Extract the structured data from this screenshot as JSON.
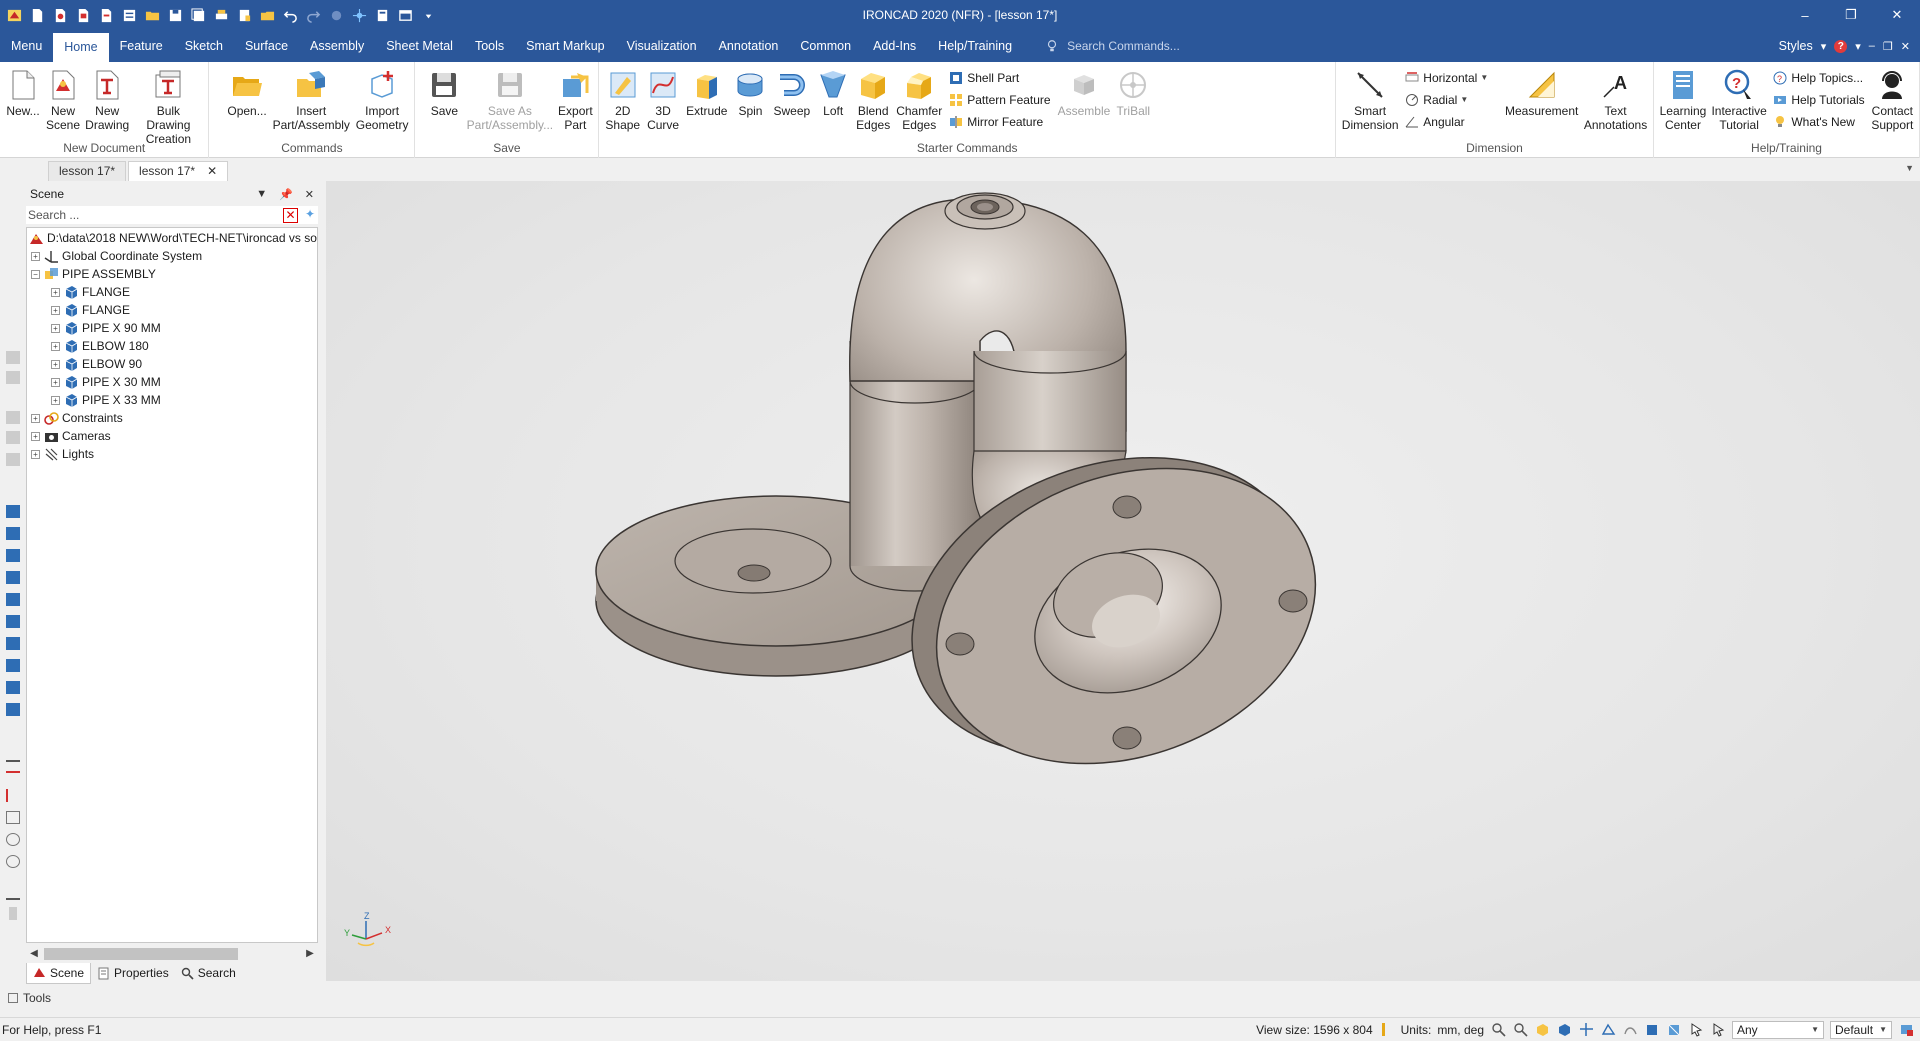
{
  "title_bar": {
    "app_title": "IRONCAD 2020 (NFR) - [lesson 17*]",
    "minimize": "–",
    "restore": "❐",
    "close": "✕"
  },
  "ribbon_tabs": [
    {
      "label": "Menu"
    },
    {
      "label": "Home"
    },
    {
      "label": "Feature"
    },
    {
      "label": "Sketch"
    },
    {
      "label": "Surface"
    },
    {
      "label": "Assembly"
    },
    {
      "label": "Sheet Metal"
    },
    {
      "label": "Tools"
    },
    {
      "label": "Smart Markup"
    },
    {
      "label": "Visualization"
    },
    {
      "label": "Annotation"
    },
    {
      "label": "Common"
    },
    {
      "label": "Add-Ins"
    },
    {
      "label": "Help/Training"
    }
  ],
  "active_tab": "Home",
  "search_commands": {
    "placeholder": "Search Commands..."
  },
  "styles_label": "Styles",
  "ribbon": {
    "new_document": {
      "label": "New Document",
      "new": "New...",
      "new_scene": "New\nScene",
      "new_drawing": "New\nDrawing",
      "bulk_drawing": "Bulk Drawing\nCreation"
    },
    "commands": {
      "label": "Commands",
      "open": "Open...",
      "insert": "Insert\nPart/Assembly",
      "import": "Import\nGeometry"
    },
    "save": {
      "label": "Save",
      "save": "Save",
      "save_as": "Save As\nPart/Assembly...",
      "export": "Export\nPart"
    },
    "starter": {
      "label": "Starter Commands",
      "shape2d": "2D\nShape",
      "curve3d": "3D\nCurve",
      "extrude": "Extrude",
      "spin": "Spin",
      "sweep": "Sweep",
      "loft": "Loft",
      "blend": "Blend\nEdges",
      "chamfer": "Chamfer\nEdges",
      "shell": "Shell Part",
      "pattern": "Pattern Feature",
      "mirror": "Mirror Feature",
      "assemble": "Assemble",
      "triball": "TriBall"
    },
    "dimension": {
      "label": "Dimension",
      "smart": "Smart\nDimension",
      "horizontal": "Horizontal",
      "radial": "Radial",
      "angular": "Angular",
      "measurement": "Measurement",
      "text_annotations": "Text\nAnnotations"
    },
    "help": {
      "label": "Help/Training",
      "learning": "Learning\nCenter",
      "interactive": "Interactive\nTutorial",
      "topics": "Help Topics...",
      "tutorials": "Help Tutorials",
      "whats_new": "What's New",
      "contact": "Contact\nSupport"
    }
  },
  "doc_tabs": [
    {
      "label": "lesson 17*"
    },
    {
      "label": "lesson 17*"
    }
  ],
  "scene_panel": {
    "title": "Scene",
    "search_placeholder": "Search ...",
    "tree": {
      "root": "D:\\data\\2018 NEW\\Word\\TECH-NET\\ironcad vs so",
      "gcs": "Global Coordinate System",
      "assembly": "PIPE ASSEMBLY",
      "parts": [
        "FLANGE",
        "FLANGE",
        "PIPE X 90 MM",
        "ELBOW 180",
        "ELBOW 90",
        "PIPE X 30 MM",
        "PIPE X 33 MM"
      ],
      "constraints": "Constraints",
      "cameras": "Cameras",
      "lights": "Lights"
    },
    "tabs": {
      "scene": "Scene",
      "properties": "Properties",
      "search": "Search"
    }
  },
  "viewport": {
    "triad": {
      "x": "X",
      "y": "Y",
      "z": "Z"
    }
  },
  "tools_bar": {
    "label": "Tools"
  },
  "status_bar": {
    "help_text": "For Help, press F1",
    "view_size": "View size: 1596 x  804",
    "units_label": "Units:",
    "units_value": "mm, deg",
    "select_filter": "Any",
    "style": "Default"
  },
  "colors": {
    "title_bar": "#2b579a",
    "part_metal": "#b5aba3",
    "viewport_bg": "#e6e6e6"
  }
}
